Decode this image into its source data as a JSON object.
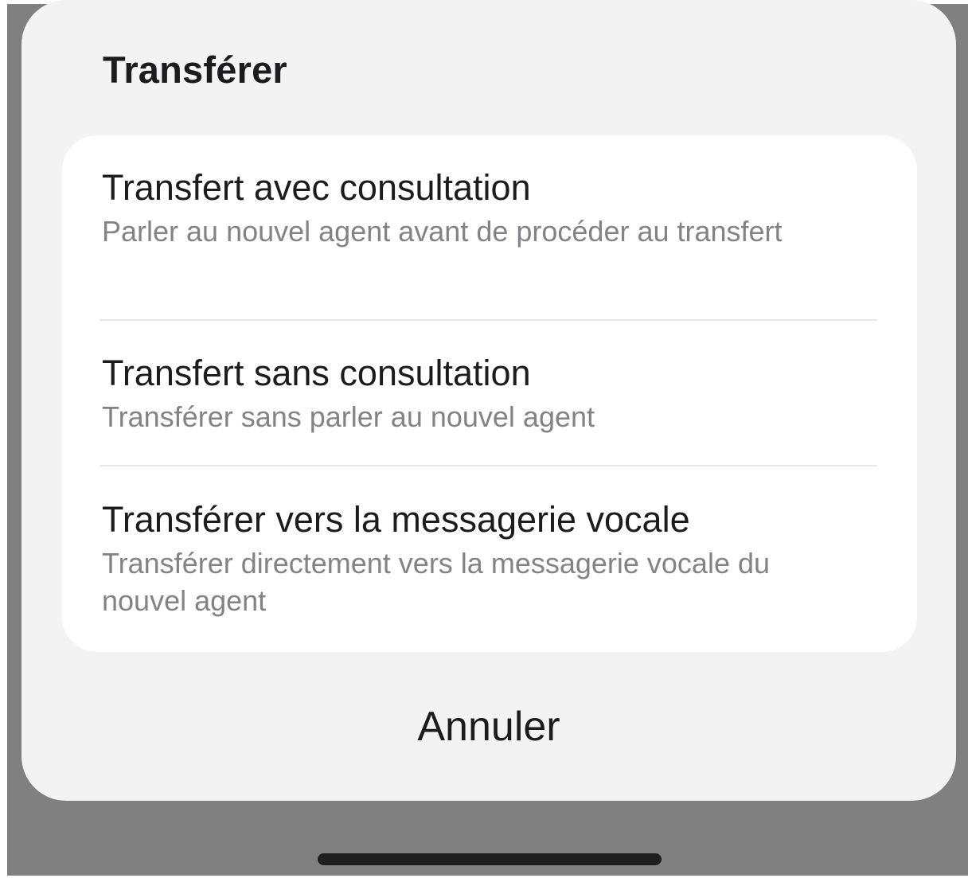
{
  "sheet": {
    "title": "Transférer",
    "options": [
      {
        "title": "Transfert avec consultation",
        "description": "Parler au nouvel agent avant de procéder au transfert"
      },
      {
        "title": "Transfert sans consultation",
        "description": "Transférer sans parler au nouvel agent"
      },
      {
        "title": "Transférer vers la messagerie vocale",
        "description": "Transférer directement vers la messagerie vocale du nouvel agent"
      }
    ],
    "cancel_label": "Annuler"
  },
  "colors": {
    "overlay": "#808080",
    "sheet_background": "#f3f3f3",
    "card_background": "#ffffff",
    "primary_text": "#1c1c1e",
    "secondary_text": "#838387",
    "divider": "#e9e9ec",
    "home_indicator": "#1e1e1e"
  }
}
